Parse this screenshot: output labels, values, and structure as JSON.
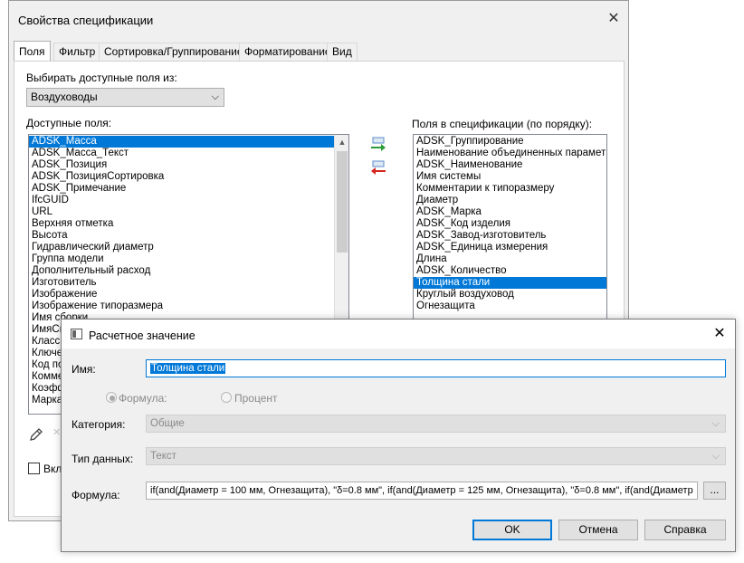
{
  "main_dialog": {
    "title": "Свойства спецификации",
    "close_glyph": "✕",
    "tabs": [
      "Поля",
      "Фильтр",
      "Сортировка/Группирование",
      "Форматирование",
      "Вид"
    ],
    "source_label": "Выбирать доступные поля из:",
    "source_value": "Воздуховоды",
    "available_label": "Доступные поля:",
    "available_fields": [
      "ADSK_Масса",
      "ADSK_Масса_Текст",
      "ADSK_Позиция",
      "ADSK_ПозицияСортировка",
      "ADSK_Примечание",
      "IfcGUID",
      "URL",
      "Верхняя отметка",
      "Высота",
      "Гидравлический диаметр",
      "Группа модели",
      "Дополнительный расход",
      "Изготовитель",
      "Изображение",
      "Изображение типоразмера",
      "Имя сборки",
      "ИмяСи",
      "Класси",
      "Ключе",
      "Код по",
      "Комме",
      "Коэфф",
      "Марка"
    ],
    "scheduled_label": "Поля в спецификации (по порядку):",
    "scheduled_fields": [
      "ADSK_Группирование",
      "Наименование объединенных параметров",
      "ADSK_Наименование",
      "Имя системы",
      "Комментарии к типоразмеру",
      "Диаметр",
      "ADSK_Марка",
      "ADSK_Код изделия",
      "ADSK_Завод-изготовитель",
      "ADSK_Единица измерения",
      "Длина",
      "ADSK_Количество",
      "Толщина стали",
      "Круглый воздуховод",
      "Огнезащита"
    ],
    "include_checkbox_label": "Вкл"
  },
  "calc_dialog": {
    "title": "Расчетное значение",
    "close_glyph": "✕",
    "name_label": "Имя:",
    "name_value": "Толщина стали",
    "radio_formula": "Формула:",
    "radio_percent": "Процент",
    "category_label": "Категория:",
    "category_value": "Общие",
    "datatype_label": "Тип данных:",
    "datatype_value": "Текст",
    "formula_label": "Формула:",
    "formula_value": "if(and(Диаметр = 100 мм, Огнезащита), \"δ=0.8 мм\", if(and(Диаметр = 125 мм, Огнезащита), \"δ=0.8 мм\", if(and(Диаметр",
    "browse_label": "...",
    "ok_label": "OK",
    "cancel_label": "Отмена",
    "help_label": "Справка"
  }
}
